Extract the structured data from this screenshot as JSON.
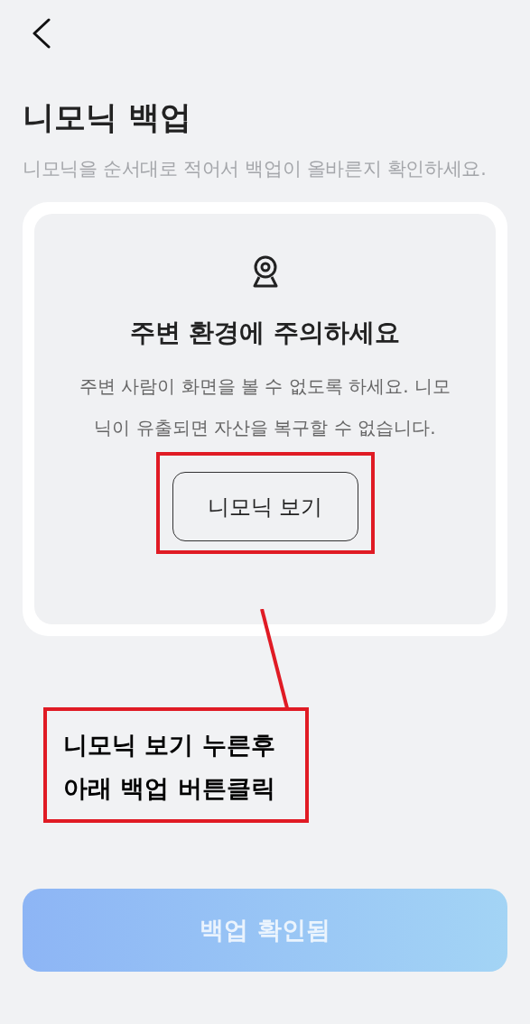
{
  "title": "니모닉 백업",
  "subtitle": "니모닉을 순서대로 적어서 백업이 올바른지 확인하세요.",
  "card": {
    "heading": "주변 환경에 주의하세요",
    "body": "주변 사람이 화면을 볼 수 없도록 하세요. 니모닉이 유출되면 자산을 복구할 수 없습니다.",
    "button": "니모닉 보기"
  },
  "annotation": {
    "lines": [
      "니모닉 보기 누른후",
      "아래 백업 버튼클릭"
    ]
  },
  "confirm_button": {
    "label": "백업 확인됨",
    "disabled": true
  }
}
